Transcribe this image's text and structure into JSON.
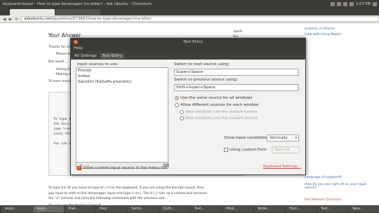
{
  "top_panel": {
    "window_title": "keyboard layout - How to type devanagari tra letter? - Ask Ubuntu - Chromium",
    "clock": "1:07 PM",
    "tray_icons": [
      "network-icon",
      "battery-icon",
      "volume-icon",
      "mail-icon",
      "power-icon"
    ]
  },
  "browser": {
    "url_host": "askubuntu.com",
    "url_path": "/questions/573667/how-to-type-devanagari-tra-letter"
  },
  "page": {
    "answer_heading": "Your Answer",
    "lines": [
      "Thanks for co",
      "Please be",
      "But avoid ...",
      "Asking fo",
      "Making s",
      "To learn more"
    ],
    "editor_lines": [
      "To type t",
      "the Inscr",
      "type l+d+",
      "joins the",
      "You can s"
    ],
    "bottom_text_1": "To type tra (त्र) you have to type त+्+र on the keyboard. If you are using the Inscript layout, then",
    "bottom_text_2": "you have to shift on the devanagari input and type l+d+j. The d (्) acts as a virama and removes",
    "bottom_text_3": "the \"a\" (schwa) and joins the following consonant with the previous one.",
    "bottom_text_4": "You can see the keyboard layout",
    "right_links": [
      "properly in Ubuntu",
      "Help with Using Nepali",
      "Language of keyboard?",
      "How do you use right alt as your input switch?",
      "Hot Network Questions"
    ],
    "side_tag": "'ward-",
    "side_tag2": "tku"
  },
  "dialog": {
    "title": "Text Entry",
    "menu_help": "Help",
    "crumbs": [
      "All Settings",
      "Text Entry"
    ],
    "sources_label": "Input sources to use:",
    "sources": [
      "Finnish",
      "Indian",
      "Sanskrit (KaGaPa phonetic)"
    ],
    "next_label": "Switch to next source using:",
    "next_value": "Super+Space",
    "prev_label": "Switch to previous source using:",
    "prev_value": "Shift+Super+Space",
    "radio_same": "Use the same source for all windows",
    "radio_allow": "Allow different sources for each window",
    "radio_default": "New windows use the default source",
    "radio_current": "New windows use the current source",
    "candidates_label": "Show input candidates:",
    "candidates_value": "Vertically",
    "custom_font_label": "Using custom Font:",
    "font_value": "Sans  10",
    "show_current_label": "Show current input source in the menu bar",
    "keyboard_settings_link": "Keyboard Settings..."
  },
  "taskbar": {
    "tasks": [
      "ossiv...",
      "keyb...",
      "Mait...",
      "Ossi",
      "Sachi...",
      "[Soft...",
      "Text...",
      "Mikk...",
      "Abde...",
      "Tryin...",
      "Text...",
      "Sele..."
    ]
  }
}
